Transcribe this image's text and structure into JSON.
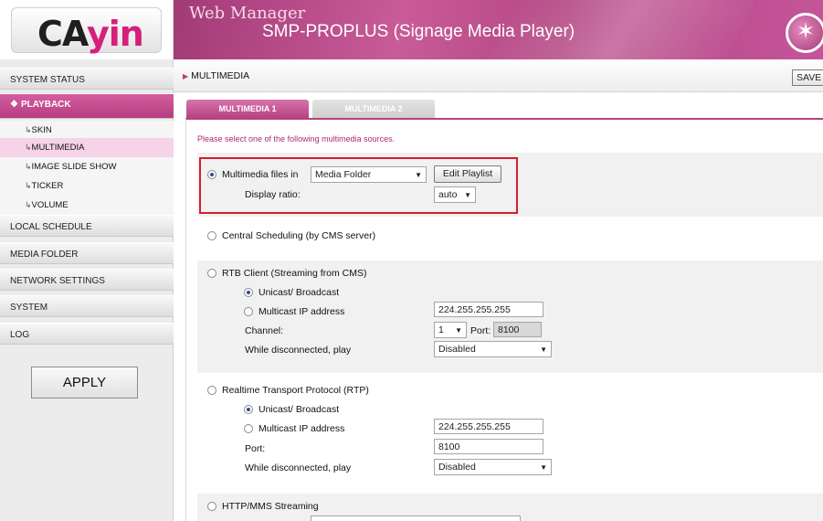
{
  "brand": {
    "logo_text_a": "CA",
    "logo_text_b": "yin"
  },
  "header": {
    "title": "Web Manager",
    "subtitle": "SMP-PROPLUS (Signage Media Player)",
    "icon": "magic-wand-icon"
  },
  "sidebar": {
    "system_status": "SYSTEM STATUS",
    "playback": "PLAYBACK",
    "sub_items": [
      "SKIN",
      "MULTIMEDIA",
      "IMAGE SLIDE SHOW",
      "TICKER",
      "VOLUME"
    ],
    "local_schedule": "LOCAL SCHEDULE",
    "media_folder": "MEDIA FOLDER",
    "network_settings": "NETWORK SETTINGS",
    "system": "SYSTEM",
    "log": "LOG",
    "apply_label": "APPLY"
  },
  "breadcrumb": {
    "label": "MULTIMEDIA",
    "save_label": "SAVE"
  },
  "tabs": [
    {
      "label": "MULTIMEDIA 1"
    },
    {
      "label": "MULTIMEDIA 2"
    }
  ],
  "notice": "Please select one of the following multimedia sources.",
  "multimedia_files": {
    "label": "Multimedia files in",
    "source_selected": "Media Folder",
    "edit_playlist_label": "Edit Playlist",
    "display_ratio_label": "Display ratio:",
    "display_ratio_selected": "auto"
  },
  "central_scheduling": {
    "label": "Central Scheduling (by CMS server)"
  },
  "rtb_client": {
    "label": "RTB Client (Streaming from CMS)",
    "unicast_label": "Unicast/ Broadcast",
    "multicast_label": "Multicast IP address",
    "multicast_ip": "224.255.255.255",
    "channel_label": "Channel:",
    "channel_selected": "1",
    "port_label": "Port:",
    "port_value": "8100",
    "disconnected_label": "While disconnected, play",
    "disconnected_selected": "Disabled"
  },
  "rtp": {
    "label": "Realtime Transport Protocol (RTP)",
    "unicast_label": "Unicast/ Broadcast",
    "multicast_label": "Multicast IP address",
    "multicast_ip": "224.255.255.255",
    "port_label": "Port:",
    "port_value": "8100",
    "disconnected_label": "While disconnected, play",
    "disconnected_selected": "Disabled"
  },
  "http_mms": {
    "label": "HTTP/MMS Streaming"
  },
  "colors": {
    "accent": "#b6427f",
    "highlight_border": "#d0202e",
    "notice_text": "#b02a74"
  }
}
